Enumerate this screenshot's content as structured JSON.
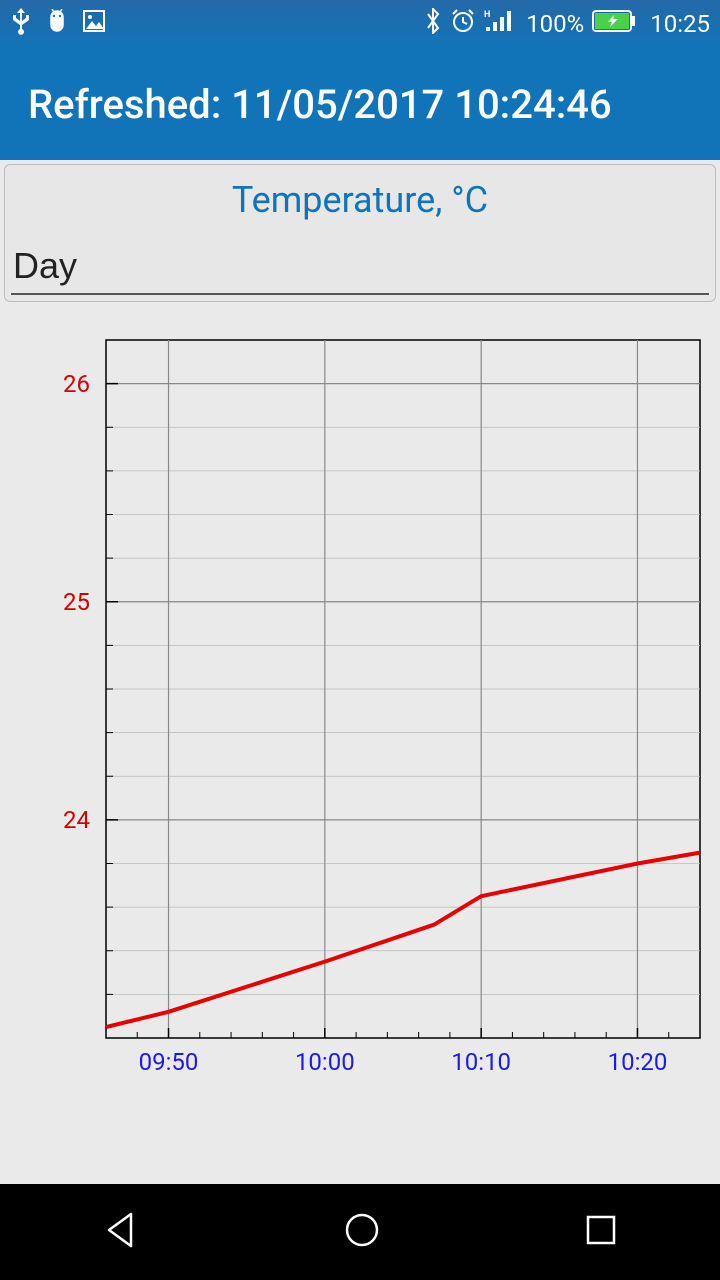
{
  "status_bar": {
    "battery_percent": "100%",
    "clock": "10:25"
  },
  "app_bar": {
    "title": "Refreshed: 11/05/2017 10:24:46"
  },
  "card": {
    "title": "Temperature, °C",
    "selector_value": "Day"
  },
  "chart_data": {
    "type": "line",
    "title": "Temperature, °C",
    "xlabel": "",
    "ylabel": "",
    "ylim": [
      23,
      26.2
    ],
    "x_ticks": [
      "09:50",
      "10:00",
      "10:10",
      "10:20"
    ],
    "y_ticks": [
      24,
      25,
      26
    ],
    "series": [
      {
        "name": "Temperature",
        "color": "#e60000",
        "x": [
          "09:46",
          "09:50",
          "10:00",
          "10:07",
          "10:10",
          "10:20",
          "10:24"
        ],
        "values": [
          23.05,
          23.12,
          23.35,
          23.52,
          23.65,
          23.8,
          23.85
        ]
      }
    ]
  }
}
